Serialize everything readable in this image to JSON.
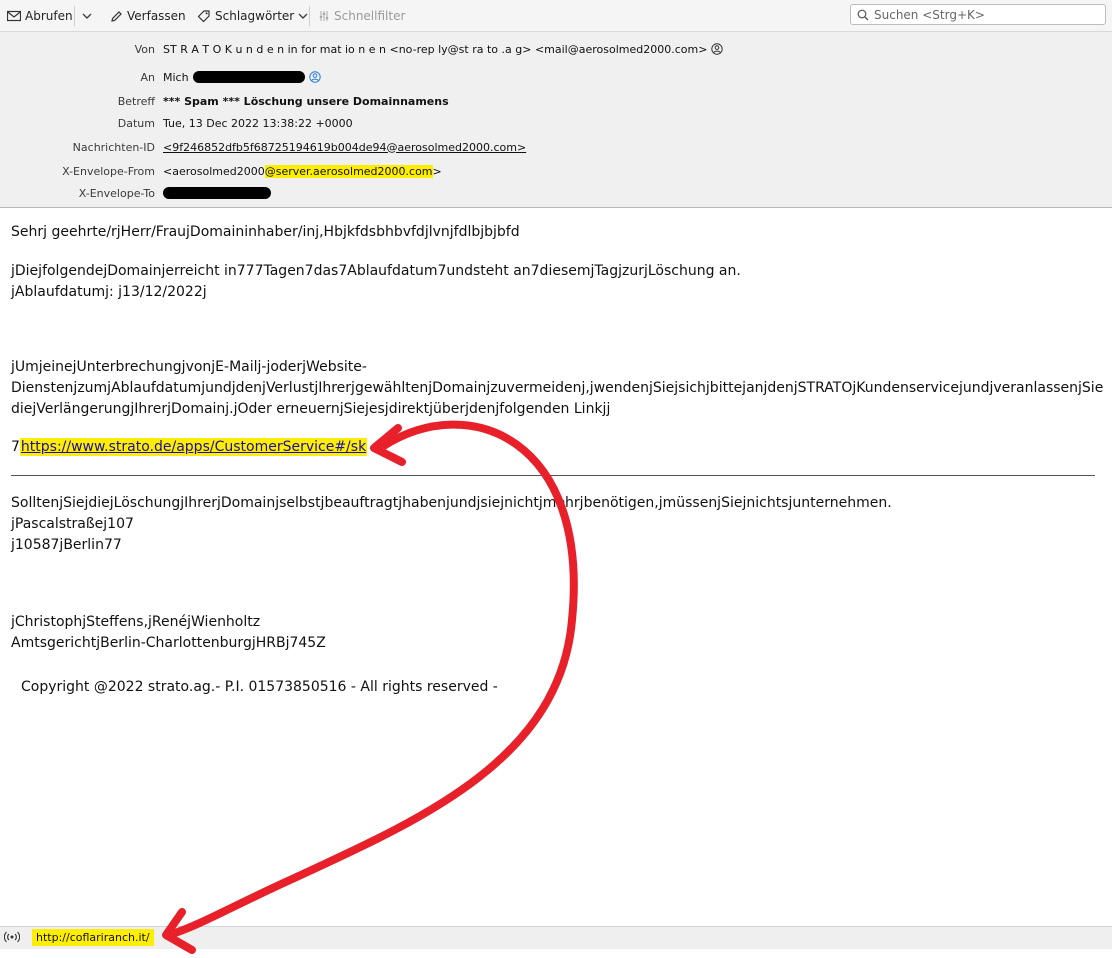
{
  "toolbar": {
    "fetch_label": "Abrufen",
    "compose_label": "Verfassen",
    "tags_label": "Schlagwörter",
    "quickfilter_label": "Schnellfilter",
    "search_placeholder": "Suchen <Strg+K>"
  },
  "headers": {
    "from_label": "Von",
    "from_value": "ST R A T O K u n d e n in for mat io n e n <no-rep ly@st ra to .a g> <mail@aerosolmed2000.com>",
    "to_label": "An",
    "to_value": "Mich",
    "subject_label": "Betreff",
    "subject_value": "*** Spam *** Löschung unsere Domainnamens",
    "date_label": "Datum",
    "date_value": "Tue, 13 Dec 2022 13:38:22 +0000",
    "msgid_label": "Nachrichten-ID",
    "msgid_value": "<9f246852dfb5f68725194619b004de94@aerosolmed2000.com>",
    "envfrom_label": "X-Envelope-From",
    "envfrom_prefix": "<aerosolmed2000",
    "envfrom_highlight": "@server.aerosolmed2000.com",
    "envfrom_suffix": ">",
    "envto_label": "X-Envelope-To"
  },
  "message": {
    "greeting": "Sehrj geehrte/rjHerr/FraujDomaininhaber/inj,Hbjkfdsbhbvfdjlvnjfdlbjbjbfd",
    "line1": "jDiejfolgendejDomainjerreicht in777Tagen7das7Ablaufdatum7undsteht an7diesemjTagjzurjLöschung an.",
    "line2": "jAblaufdatumj: j13/12/2022j",
    "line3a": "jUmjeinejUnterbrechungjvonjE-Mailj-joderjWebsite-",
    "line3b": "DienstenjzumjAblaufdatumjundjdenjVerlustjIhrerjgewähltenjDomainjzuvermeidenj,jwendenjSiejsichjbittejanjdenjSTRATOjKundenservicejundjveranlassenjSie",
    "line3c": "diejVerlängerungjIhrerjDomainj.jOder erneuernjSiejesjdirektjüberjdenjfolgenden Linkjj",
    "link_prefix": "7",
    "link_text": "https://www.strato.de/apps/CustomerService#/sk",
    "line4": "SolltenjSiejdiejLöschungjIhrerjDomainjselbstjbeauftragtjhabenjundjsiejnichtjmehrjbenötigen,jmüssenjSiejnichtsjunternehmen.",
    "line5": "jPascalstraßej107",
    "line6": "j10587jBerlin77",
    "line7": "jChristophjSteffens,jRenéjWienholtz",
    "line8": "AmtsgerichtjBerlin-CharlottenburgjHRBj745Z",
    "copyright": "Copyright @2022 strato.ag.- P.I. 01573850516 - All rights reserved -"
  },
  "status": {
    "url": "http://coflariranch.it/"
  },
  "colors": {
    "highlight": "#ffee00",
    "arrow": "#e8202a",
    "link": "#1a0dab"
  }
}
